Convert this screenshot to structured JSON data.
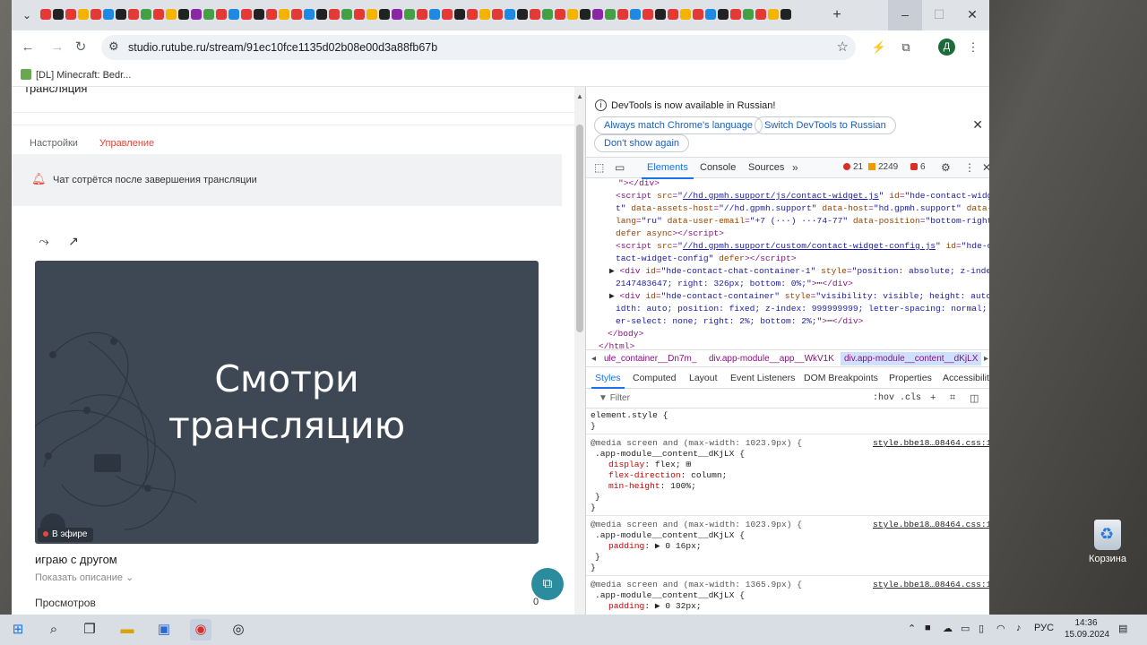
{
  "browser": {
    "url": "studio.rutube.ru/stream/91ec10fce1135d02b08e00d3a88fb67b",
    "bookmark": "[DL] Minecraft: Bedr...",
    "profile_initial": "Д",
    "new_tab": "+",
    "minimize": "–",
    "maximize": "☐",
    "close": "✕"
  },
  "page": {
    "truncated_heading": "трансляция",
    "tabs": [
      "Настройки",
      "Управление"
    ],
    "notice": "Чат сотрётся после завершения трансляции",
    "player_text_line1": "Смотри",
    "player_text_line2": "трансляцию",
    "live_label": "В эфире",
    "stream_title": "играю с другом",
    "show_description": "Показать описание",
    "views_label": "Просмотров",
    "views_value": "0"
  },
  "devtools": {
    "info_message": "DevTools is now available in Russian!",
    "buttons": [
      "Always match Chrome's language",
      "Switch DevTools to Russian",
      "Don't show again"
    ],
    "tabs": [
      "Elements",
      "Console",
      "Sources"
    ],
    "errors": "21",
    "warnings": "2249",
    "issues": "6",
    "breadcrumbs": [
      "ule_container__Dn7m_",
      "div.app-module__app__WkV1K",
      "div.app-module__content__dKjLX"
    ],
    "subtabs": [
      "Styles",
      "Computed",
      "Layout",
      "Event Listeners",
      "DOM Breakpoints",
      "Properties",
      "Accessibility"
    ],
    "filter_placeholder": "Filter",
    "hov_cls": ":hov .cls",
    "style_source": "style.bbe18…08464.css:1"
  },
  "desktop": {
    "recycle_bin": "Корзина"
  },
  "taskbar": {
    "language": "РУС",
    "time": "14:36",
    "date": "15.09.2024"
  }
}
